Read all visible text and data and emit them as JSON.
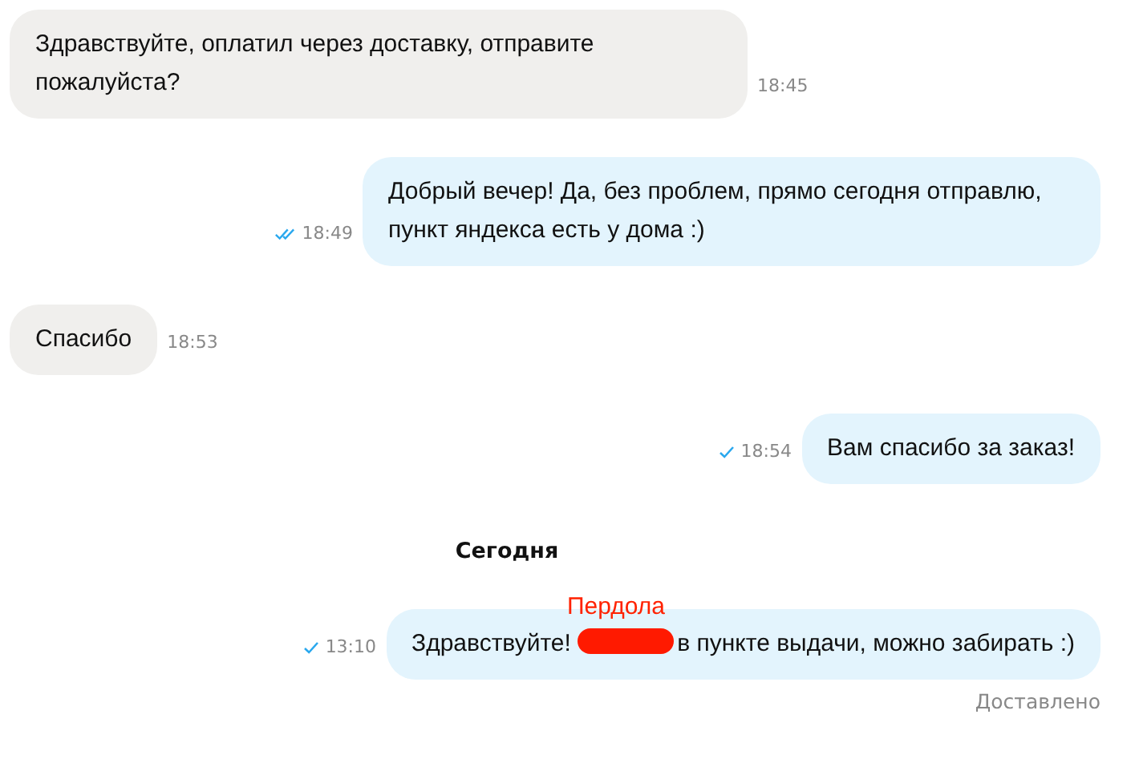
{
  "messages": [
    {
      "kind": "incoming",
      "text": "Здравствуйте, оплатил через доставку, отправите пожалуйста?",
      "time": "18:45"
    },
    {
      "kind": "outgoing",
      "text": "Добрый вечер! Да, без проблем, прямо сегодня отправлю, пункт яндекса есть у дома :)",
      "time": "18:49",
      "read": true
    },
    {
      "kind": "incoming",
      "text": "Спасибо",
      "time": "18:53"
    },
    {
      "kind": "outgoing",
      "text": "Вам спасибо за заказ!",
      "time": "18:54",
      "read": false
    },
    {
      "kind": "date",
      "text": "Сегодня"
    },
    {
      "kind": "outgoing",
      "text": "Здравствуйте!",
      "redacted": true,
      "annotation": "Пердола",
      "text_after": "в пункте выдачи, можно забирать :)",
      "time": "13:10",
      "read": false,
      "status": "Доставлено"
    }
  ]
}
